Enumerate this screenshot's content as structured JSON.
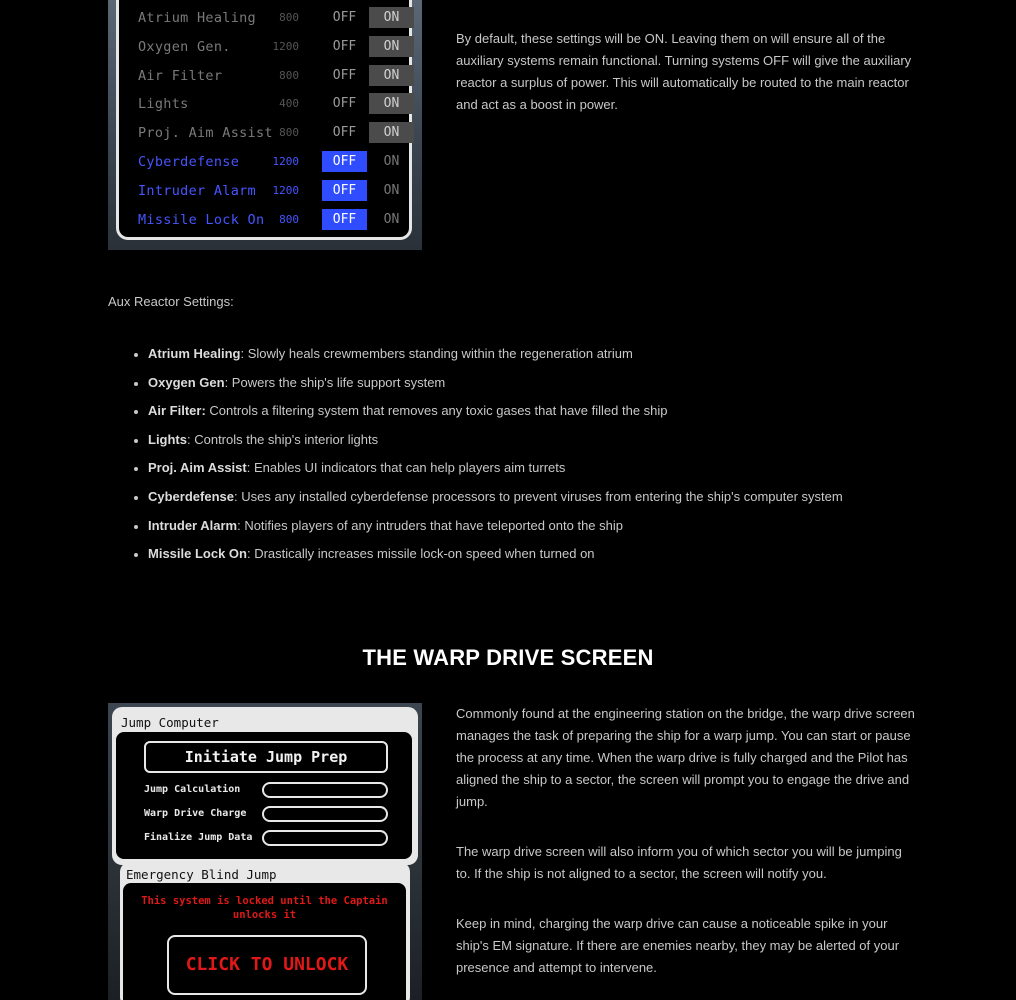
{
  "aux_panel": {
    "rows": [
      {
        "name": "Atrium Healing",
        "power": "800",
        "off_label": "OFF",
        "on_label": "ON",
        "state": "on"
      },
      {
        "name": "Oxygen Gen.",
        "power": "1200",
        "off_label": "OFF",
        "on_label": "ON",
        "state": "on"
      },
      {
        "name": "Air Filter",
        "power": "800",
        "off_label": "OFF",
        "on_label": "ON",
        "state": "on"
      },
      {
        "name": "Lights",
        "power": "400",
        "off_label": "OFF",
        "on_label": "ON",
        "state": "on"
      },
      {
        "name": "Proj. Aim Assist",
        "power": "800",
        "off_label": "OFF",
        "on_label": "ON",
        "state": "on"
      },
      {
        "name": "Cyberdefense",
        "power": "1200",
        "off_label": "OFF",
        "on_label": "ON",
        "state": "off"
      },
      {
        "name": "Intruder Alarm",
        "power": "1200",
        "off_label": "OFF",
        "on_label": "ON",
        "state": "off"
      },
      {
        "name": "Missile Lock On",
        "power": "800",
        "off_label": "OFF",
        "on_label": "ON",
        "state": "off"
      }
    ],
    "colors": {
      "on_highlight": "#4b4b4b",
      "off_highlight": "#2f4dff",
      "off_text": "#4655ff"
    }
  },
  "intro": {
    "paragraph": "By default, these settings will be ON. Leaving them on will ensure all of the auxiliary systems remain functional. Turning systems OFF will give the auxiliary reactor a surplus of power. This will automatically be routed to the main reactor and act as a boost in power."
  },
  "aux_settings": {
    "heading": "Aux Reactor Settings:",
    "items": [
      {
        "term": "Atrium Healing",
        "desc": ": Slowly heals crewmembers standing within the regeneration atrium"
      },
      {
        "term": "Oxygen Gen",
        "desc": ": Powers the ship's life support system"
      },
      {
        "term": "Air Filter:",
        "desc": " Controls a filtering system that removes any toxic gases that have filled the ship"
      },
      {
        "term": "Lights",
        "desc": ": Controls the ship's interior lights"
      },
      {
        "term": "Proj. Aim Assist",
        "desc": ": Enables UI indicators that can help players aim turrets"
      },
      {
        "term": "Cyberdefense",
        "desc": ": Uses any installed cyberdefense processors to prevent viruses from entering the ship's computer system"
      },
      {
        "term": "Intruder Alarm",
        "desc": ": Notifies players of any intruders that have teleported onto the ship"
      },
      {
        "term": "Missile Lock On",
        "desc": ": Drastically increases missile lock-on speed when turned on"
      }
    ]
  },
  "warp_section": {
    "title": "THE WARP DRIVE SCREEN",
    "jump_computer": {
      "title": "Jump Computer",
      "prep_button": "Initiate Jump Prep",
      "progress": [
        {
          "label": "Jump Calculation",
          "fraction": 0
        },
        {
          "label": "Warp Drive Charge",
          "fraction": 0
        },
        {
          "label": "Finalize Jump Data",
          "fraction": 0
        }
      ]
    },
    "blind_jump": {
      "title": "Emergency Blind Jump",
      "locked_message": "This system is locked until the Captain unlocks it",
      "unlock_button": "CLICK TO UNLOCK",
      "alert_color": "#e01818"
    },
    "paragraphs": [
      "Commonly found at the engineering station on the bridge, the warp drive screen manages the task of preparing the ship for a warp jump. You can start or pause the process at any time. When the warp drive is fully charged and the Pilot has aligned the ship to a sector, the screen will prompt you to engage the drive and jump.",
      "The warp drive screen will also inform you of which sector you will be jumping to. If the ship is not aligned to a sector, the screen will notify you.",
      "Keep in mind, charging the warp drive can cause a noticeable spike in your ship's EM signature. If there are enemies nearby, they may be alerted of your presence and attempt to intervene."
    ]
  }
}
